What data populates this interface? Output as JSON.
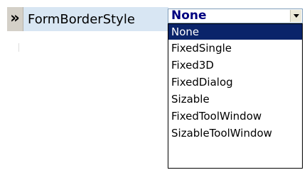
{
  "property_row": {
    "icon": "chevron-double-right-icon",
    "name": "FormBorderStyle"
  },
  "combo": {
    "value": "None",
    "button_icon": "arrow-down-icon"
  },
  "dropdown": {
    "items": [
      {
        "label": "None",
        "selected": true
      },
      {
        "label": "FixedSingle",
        "selected": false
      },
      {
        "label": "Fixed3D",
        "selected": false
      },
      {
        "label": "FixedDialog",
        "selected": false
      },
      {
        "label": "Sizable",
        "selected": false
      },
      {
        "label": "FixedToolWindow",
        "selected": false
      },
      {
        "label": "SizableToolWindow",
        "selected": false
      }
    ]
  },
  "colors": {
    "property_name_bg": "#d8e6f3",
    "selection_bg": "#0a246a",
    "combo_value_text": "#000080"
  }
}
